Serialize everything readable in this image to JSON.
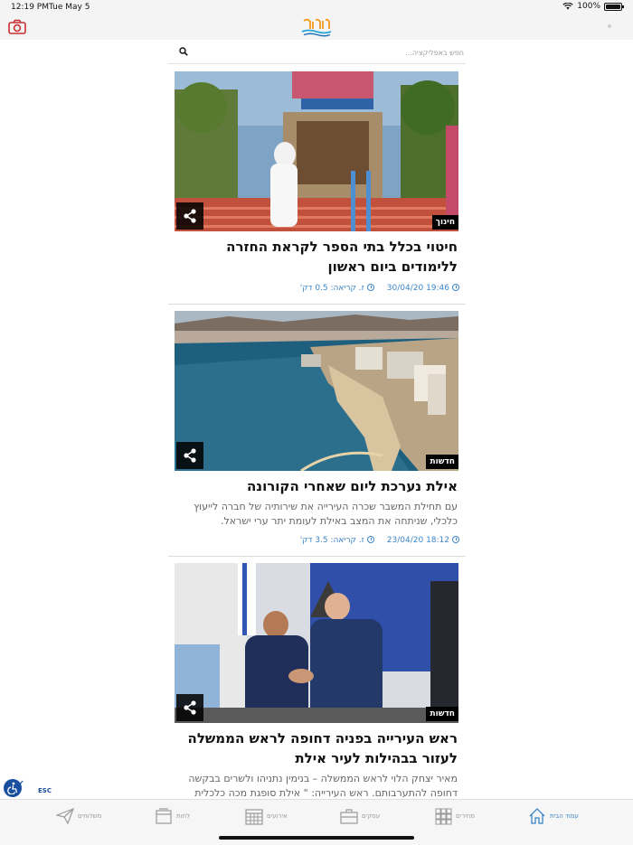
{
  "status_bar": {
    "time": "12:19 PM",
    "date": "Tue May 5",
    "battery": "100%"
  },
  "header": {
    "logo_alt": "באילת"
  },
  "search": {
    "placeholder": "חפש באפליקציה..."
  },
  "articles": [
    {
      "category": "חינוך",
      "title": "חיטוי בכלל בתי הספר לקראת החזרה ללימודים ביום ראשון",
      "excerpt": "",
      "datetime": "19:46 30/04/20",
      "read_time": "ז. קריאה: 0.5 דק'"
    },
    {
      "category": "חדשות",
      "title": "אילת נערכת ליום שאחרי הקורונה",
      "excerpt": "עם תחילת המשבר שכרה העירייה את שירותיה של חברה לייעוץ כלכלי, שניתחה את המצב באילת לעומת יתר ערי ישראל.",
      "datetime": "18:12 23/04/20",
      "read_time": "ז. קריאה: 3.5 דק'"
    },
    {
      "category": "חדשות",
      "title": "ראש העירייה בפניה דחופה לראש הממשלה לעזור בבהילות לעיר אילת",
      "excerpt": "מאיר יצחק הלוי לראש הממשלה – בנימין נתניהו ולשרים בבקשה דחופה להתערבותם. ראש העירייה: \" אילת סופגת מכה כלכלית וחברתית אנ...",
      "datetime": "",
      "read_time": ""
    }
  ],
  "accessibility": {
    "esc": "ESC",
    "check": "✔"
  },
  "tab_bar": {
    "home": "עמוד הבית",
    "coupons": "מחירים",
    "business": "עסקים",
    "events": "אירועים",
    "tenders": "לחות",
    "messages": "משלוחים"
  }
}
